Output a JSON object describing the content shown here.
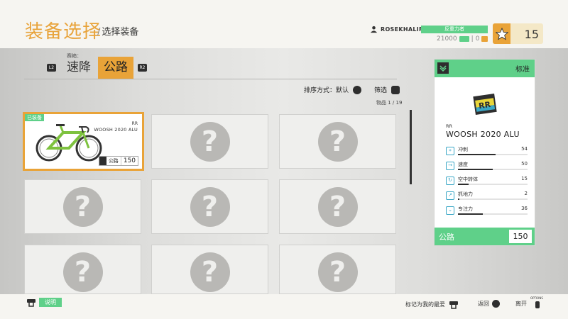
{
  "header": {
    "title": "装备选择",
    "separator": "/",
    "subtitle": "选择装备",
    "username": "ROSEKHALIFA12",
    "rep_label": "反重力者",
    "cash": "21000",
    "tickets": "0",
    "stars": "15"
  },
  "tabs": {
    "label": "赛箱：",
    "left_hint": "L2",
    "right_hint": "R2",
    "items": [
      {
        "label": "速降",
        "active": false
      },
      {
        "label": "公路",
        "active": true
      }
    ]
  },
  "sort": {
    "label": "排序方式：",
    "value": "默认",
    "filter_label": "筛选",
    "count": "物品 1 / 19"
  },
  "grid": {
    "selected": {
      "equipped": "已装备",
      "brand": "RR",
      "model": "WOOSH 2020 ALU",
      "class": "公路",
      "value": "150"
    }
  },
  "panel": {
    "header": "标准",
    "brand": "RR",
    "model": "WOOSH 2020 ALU",
    "stats": [
      {
        "name": "冲刺",
        "value": "54",
        "level": 0.54,
        "icon": "sprint-icon"
      },
      {
        "name": "速度",
        "value": "50",
        "level": 0.5,
        "icon": "speed-icon"
      },
      {
        "name": "空中转体",
        "value": "15",
        "level": 0.15,
        "icon": "air-spin-icon"
      },
      {
        "name": "抓地力",
        "value": "2",
        "level": 0.02,
        "icon": "grip-icon"
      },
      {
        "name": "专注力",
        "value": "36",
        "level": 0.36,
        "icon": "focus-icon"
      }
    ],
    "class": "公路",
    "value": "150"
  },
  "footer": {
    "help": "说明",
    "favorite": "标记为我的最爱",
    "back": "返回",
    "exit": "离开",
    "options": "OPTIONS"
  },
  "colors": {
    "accent": "#e9a338",
    "green": "#5fd089",
    "dark": "#2e2e2e"
  }
}
